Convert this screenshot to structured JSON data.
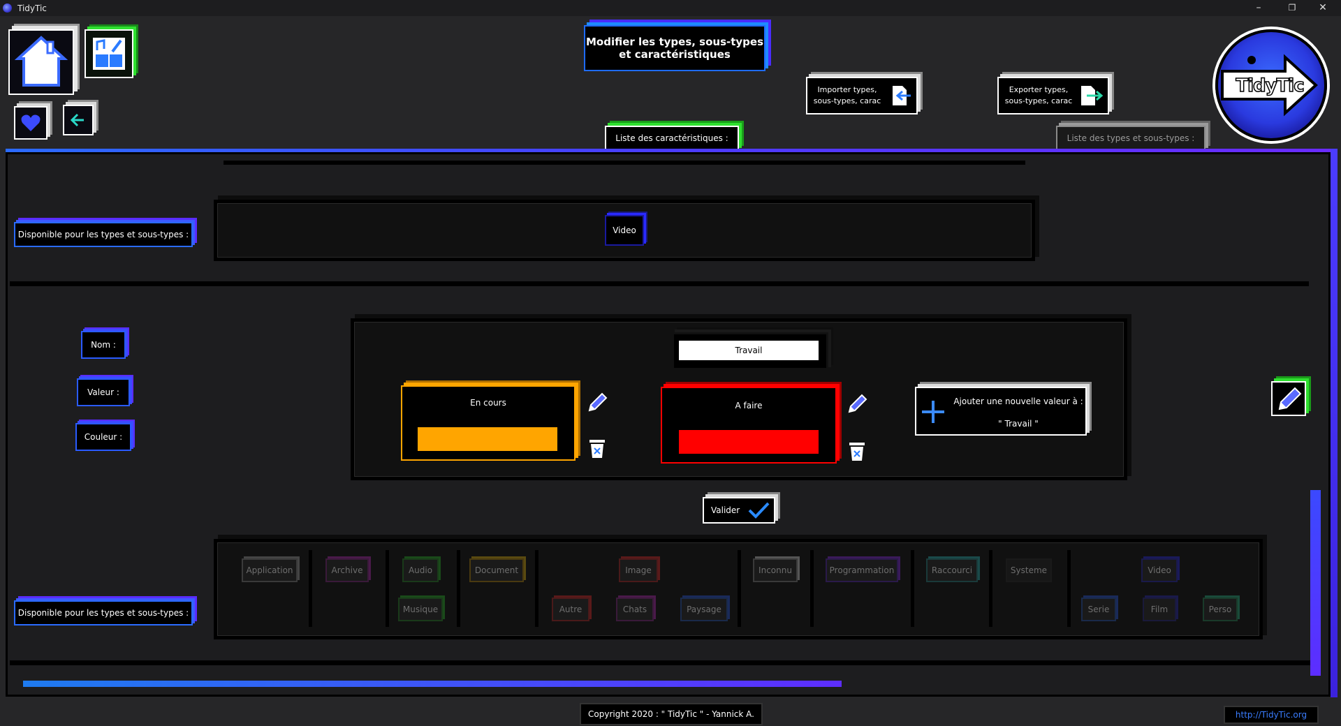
{
  "window": {
    "title": "TidyTic"
  },
  "header": {
    "title_line1": "Modifier les types, sous-types",
    "title_line2": "et caractéristiques",
    "import_line1": "Importer types,",
    "import_line2": "sous-types, carac",
    "export_line1": "Exporter types,",
    "export_line2": "sous-types, carac",
    "tab_carac": "Liste des caractéristiques :",
    "tab_types": "Liste des types et sous-types :",
    "logo_text": "TidyTic"
  },
  "section1": {
    "available_label": "Disponible pour les types et sous-types :",
    "type_chip": "Video"
  },
  "editor": {
    "nom_label": "Nom :",
    "valeur_label": "Valeur :",
    "couleur_label": "Couleur :",
    "name_value": "Travail",
    "values": [
      {
        "label": "En cours",
        "color": "#ffa500"
      },
      {
        "label": "A faire",
        "color": "#ff0000"
      }
    ],
    "add_value_line1": "Ajouter une nouvelle valeur à :",
    "add_value_line2": "\" Travail \"",
    "validate": "Valider"
  },
  "section2": {
    "available_label": "Disponible pour les types et sous-types :",
    "types": {
      "application": "Application",
      "archive": "Archive",
      "audio": "Audio",
      "musique": "Musique",
      "document": "Document",
      "image": "Image",
      "autre": "Autre",
      "chats": "Chats",
      "paysage": "Paysage",
      "inconnu": "Inconnu",
      "programmation": "Programmation",
      "raccourci": "Raccourci",
      "systeme": "Systeme",
      "video": "Video",
      "serie": "Serie",
      "film": "Film",
      "perso": "Perso"
    }
  },
  "footer": {
    "copyright": "Copyright 2020 : \" TidyTic \" - Yannick A.",
    "url": "http://TidyTic.org"
  },
  "colors": {
    "accent_blue": "#2b6bff",
    "accent_purple": "#6a2cff",
    "green": "#2fe02f",
    "orange": "#ffa500",
    "red": "#ff0000"
  }
}
